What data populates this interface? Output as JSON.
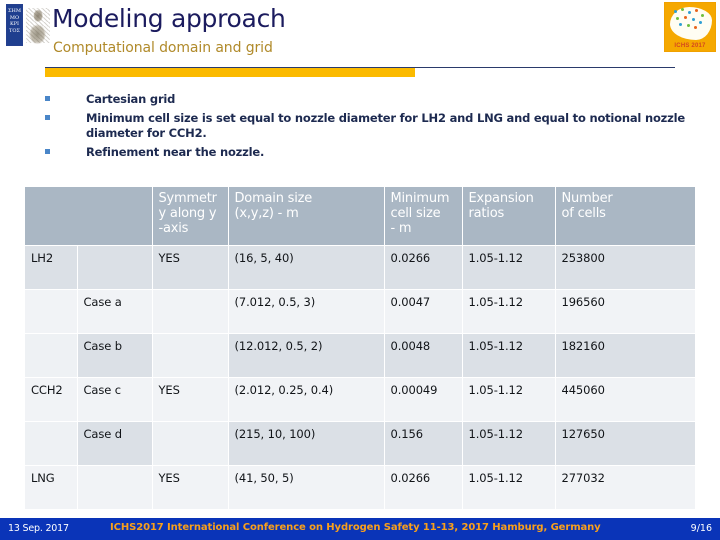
{
  "header": {
    "title": "Modeling approach",
    "subtitle": "Computational domain and grid",
    "left_logo_lines": "ΣΗΜ\nΜΟ\nΚΡΙ\nΤΟΣ",
    "right_logo_label": "ICHS 2017"
  },
  "bullets": [
    "Cartesian grid",
    "Minimum cell size is set equal to nozzle diameter for LH2 and LNG and equal to notional nozzle diameter for CCH2.",
    "Refinement near the nozzle."
  ],
  "table": {
    "headers": [
      "",
      "",
      "Symmetry along y -axis",
      "Domain size (x,y,z) - m",
      "Minimum cell size - m",
      "Expansion ratios",
      "Number of cells"
    ],
    "header_lines": {
      "symmetry": [
        "Symmetr",
        "y along y",
        "-axis"
      ],
      "domain": [
        "Domain size",
        "(x,y,z) - m"
      ],
      "mincell": [
        "Minimum",
        "cell size",
        "- m"
      ],
      "expansion": [
        "Expansion",
        "ratios"
      ],
      "numcells": [
        "Number",
        "of cells"
      ]
    },
    "rows": [
      {
        "fuel": "LH2",
        "case": "",
        "symmetry": "YES",
        "domain": "(16, 5, 40)",
        "min_cell": "0.0266",
        "expansion": "1.05-1.12",
        "cells": "253800"
      },
      {
        "fuel": "",
        "case": "Case a",
        "symmetry": "",
        "domain": "(7.012, 0.5, 3)",
        "min_cell": "0.0047",
        "expansion": "1.05-1.12",
        "cells": "196560"
      },
      {
        "fuel": "",
        "case": "Case b",
        "symmetry": "",
        "domain": "(12.012, 0.5, 2)",
        "min_cell": "0.0048",
        "expansion": "1.05-1.12",
        "cells": "182160"
      },
      {
        "fuel": "CCH2",
        "case": "Case c",
        "symmetry": "YES",
        "domain": "(2.012, 0.25, 0.4)",
        "min_cell": "0.00049",
        "expansion": "1.05-1.12",
        "cells": "445060"
      },
      {
        "fuel": "",
        "case": "Case d",
        "symmetry": "",
        "domain": "(215, 10, 100)",
        "min_cell": "0.156",
        "expansion": "1.05-1.12",
        "cells": "127650"
      },
      {
        "fuel": "LNG",
        "case": "",
        "symmetry": "YES",
        "domain": "(41, 50, 5)",
        "min_cell": "0.0266",
        "expansion": "1.05-1.12",
        "cells": "277032"
      }
    ]
  },
  "footer": {
    "date": "13 Sep. 2017",
    "conference": "ICHS2017 International Conference on Hydrogen Safety 11-13, 2017 Hamburg, Germany",
    "page": "9/16"
  },
  "colors": {
    "title": "#1b1b5e",
    "subtitle": "#b08a2a",
    "accent_bar": "#fbba00",
    "rule": "#2a3a6b",
    "bullet": "#4a86c8",
    "table_header_bg": "#aab7c4",
    "row_dark": "#dbe0e6",
    "row_light": "#f1f3f6",
    "footer_bg": "#0a34b8",
    "footer_text": "#f9a01b"
  }
}
